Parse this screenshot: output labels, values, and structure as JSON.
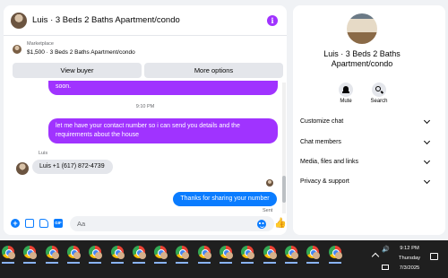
{
  "chat": {
    "title": "Luis · 3 Beds 2 Baths Apartment/condo",
    "marketplace_label": "Marketplace",
    "listing": "$1,500 · 3 Beds 2 Baths Apartment/condo",
    "view_buyer_label": "View buyer",
    "more_options_label": "More options",
    "messages": {
      "m1": "soon.",
      "timestamp": "9:10 PM",
      "m2": "let me have your contact number so i can send you details and the requirements about the house",
      "sender_name": "Luis",
      "m3": "Luis +1 (617) 872-4739",
      "m4": "Thanks for sharing your number",
      "status": "Sent"
    },
    "composer": {
      "placeholder": "Aa",
      "gif_label": "GIF"
    }
  },
  "side_panel": {
    "name": "Luis · 3 Beds 2 Baths Apartment/condo",
    "mute_label": "Mute",
    "search_label": "Search",
    "menu": [
      "Customize chat",
      "Chat members",
      "Media, files and links",
      "Privacy & support"
    ]
  },
  "taskbar": {
    "app_icons": [
      "chrome-profile-icon"
    ],
    "time": "9:12 PM",
    "day": "Thursday",
    "date": "7/3/2025"
  },
  "colors": {
    "outgoing_purple": "#a033ff",
    "outgoing_blue": "#0a7cff",
    "incoming_gray": "#e4e6eb"
  }
}
